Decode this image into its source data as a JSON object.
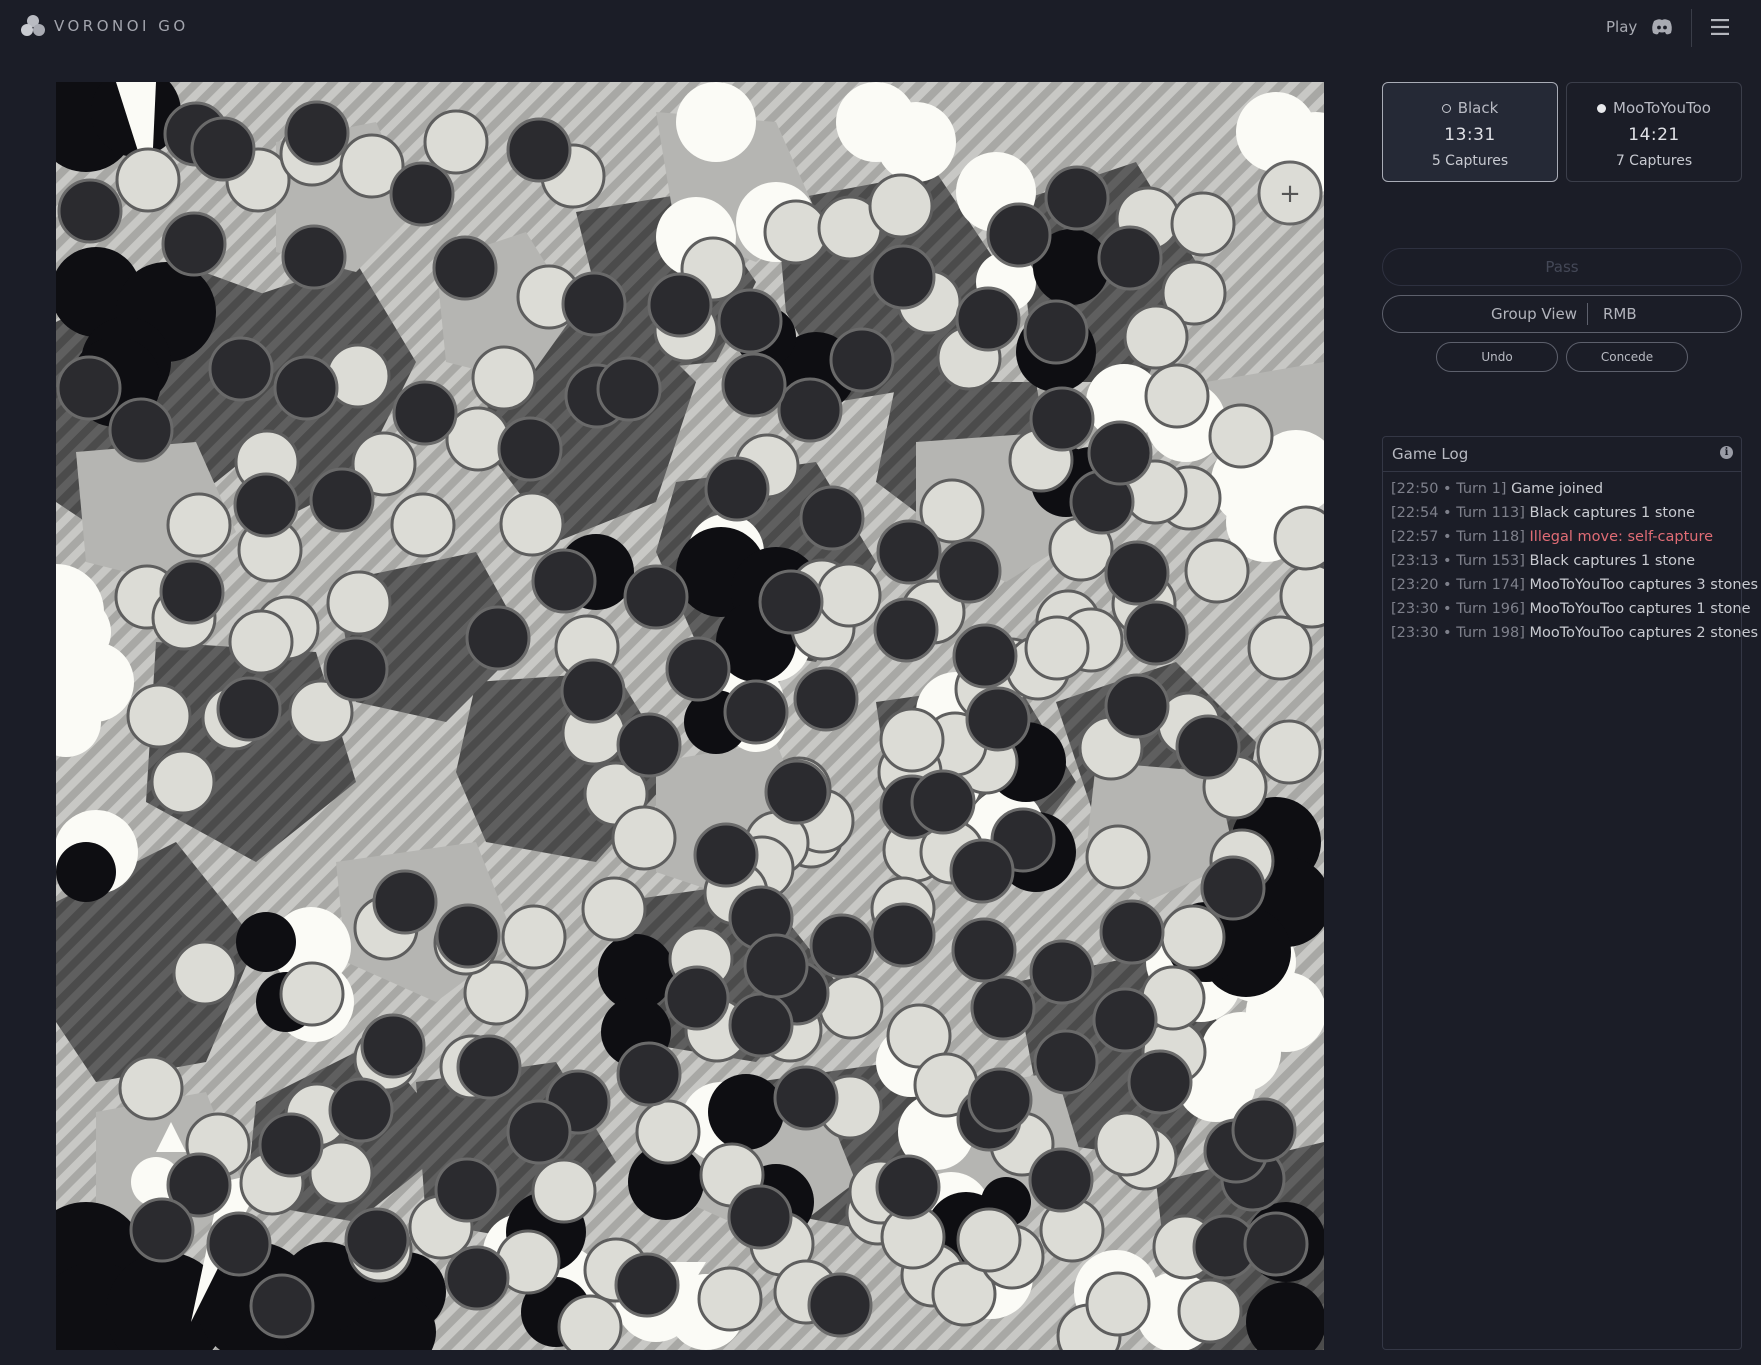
{
  "app": {
    "title": "VORONOI GO"
  },
  "nav": {
    "play": "Play",
    "discord_icon": "discord-icon",
    "menu_icon": "hamburger-menu-icon"
  },
  "board": {
    "add_button": "+",
    "colors": {
      "stripe_light": "#c8c8c5",
      "stripe_dark": "#4b4b4b",
      "light_territory": "#b5b5b2",
      "dark_territory": "#3a3a3a",
      "white_stone": "#dcdcd6",
      "black_stone": "#2b2b2f",
      "captured_white": "#fbfbf6",
      "captured_black": "#0e0e12"
    }
  },
  "players": [
    {
      "name": "Black",
      "time": "13:31",
      "captures": "5 Captures",
      "active": true
    },
    {
      "name": "MooToYouToo",
      "time": "14:21",
      "captures": "7 Captures",
      "active": false
    }
  ],
  "controls": {
    "pass": "Pass",
    "group_view": "Group View",
    "rmb": "RMB",
    "undo": "Undo",
    "concede": "Concede"
  },
  "game_log": {
    "title": "Game Log",
    "info_icon": "info-icon",
    "entries": [
      {
        "meta": "[22:50 • Turn 1]",
        "text": "Game joined",
        "warn": false
      },
      {
        "meta": "[22:54 • Turn 113]",
        "text": "Black captures 1 stone",
        "warn": false
      },
      {
        "meta": "[22:57 • Turn 118]",
        "text": "Illegal move: self-capture",
        "warn": true
      },
      {
        "meta": "[23:13 • Turn 153]",
        "text": "Black captures 1 stone",
        "warn": false
      },
      {
        "meta": "[23:20 • Turn 174]",
        "text": "MooToYouToo captures 3 stones",
        "warn": false
      },
      {
        "meta": "[23:30 • Turn 196]",
        "text": "MooToYouToo captures 1 stone",
        "warn": false
      },
      {
        "meta": "[23:30 • Turn 198]",
        "text": "MooToYouToo captures 2 stones",
        "warn": false
      }
    ]
  }
}
